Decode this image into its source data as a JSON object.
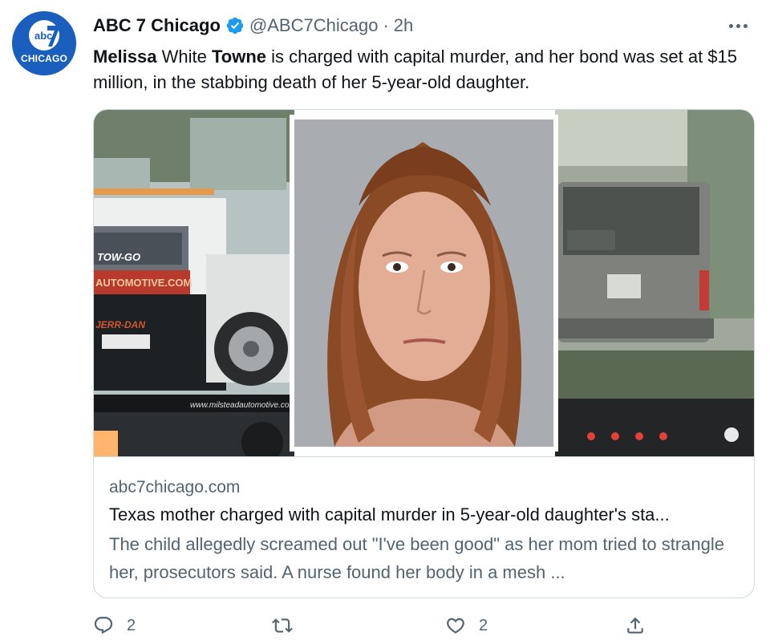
{
  "account": {
    "name": "ABC 7 Chicago",
    "handle": "@ABC7Chicago",
    "separator": "·",
    "time": "2h",
    "avatar_logo_text": "abc",
    "avatar_subtext": "CHICAGO",
    "brand_color": "#1a5fbd",
    "verified_color": "#1d9bf0"
  },
  "tweet": {
    "text_parts": [
      "Melissa",
      " White ",
      "Towne",
      " is charged with capital murder, and her bond was set at $15 million, in the stabbing death of her 5-year-old daughter."
    ]
  },
  "card": {
    "domain": "abc7chicago.com",
    "title": "Texas mother charged with capital murder in 5-year-old daughter's sta...",
    "description": "The child allegedly screamed out \"I've been good\" as her mom tried to strangle her, prosecutors said. A nurse found her body in a mesh ...",
    "image_text": {
      "tow_logo": "TOW-GO",
      "automotive": "AUTOMOTIVE.COM",
      "jerr_dan": "JERR-DAN",
      "website": "www.milsteadautomotive.com"
    }
  },
  "actions": {
    "reply_count": "2",
    "like_count": "2",
    "icons": [
      "reply-icon",
      "retweet-icon",
      "like-icon",
      "share-icon"
    ]
  },
  "colors": {
    "text_primary": "#0f1419",
    "text_secondary": "#536471",
    "border": "#cfd9de"
  }
}
